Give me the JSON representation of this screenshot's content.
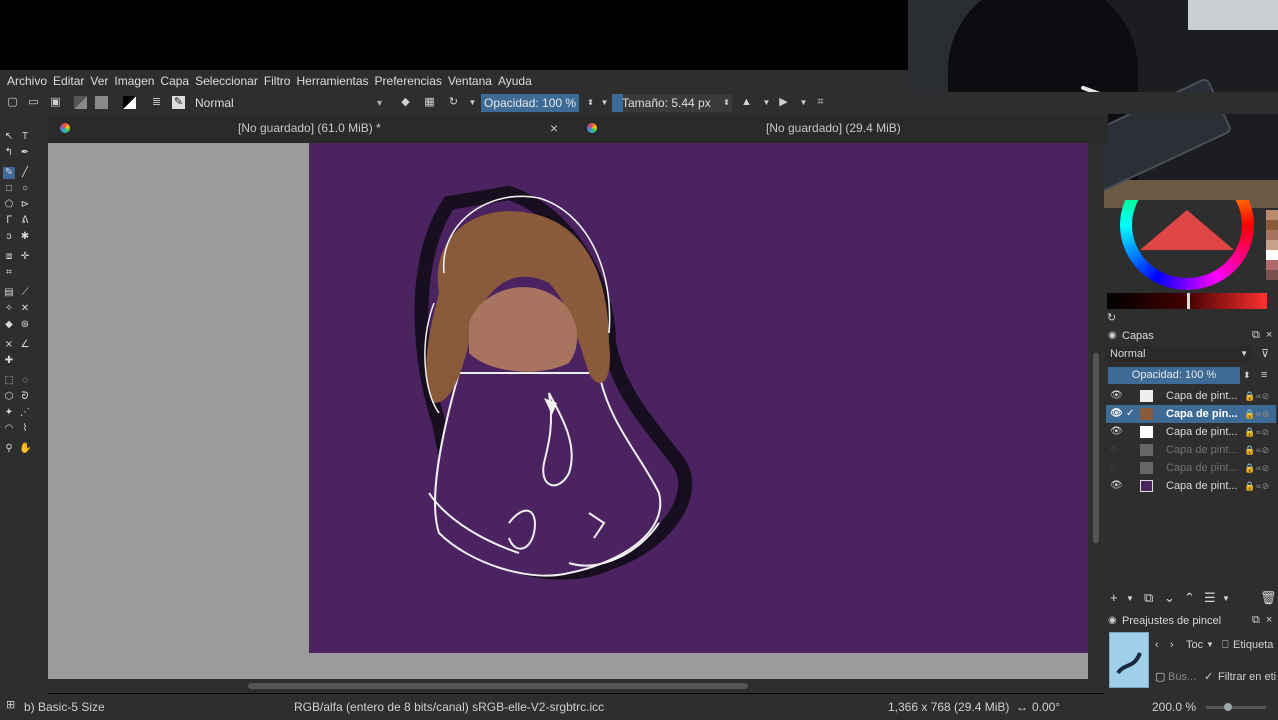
{
  "menu": [
    "Archivo",
    "Editar",
    "Ver",
    "Imagen",
    "Capa",
    "Seleccionar",
    "Filtro",
    "Herramientas",
    "Preferencias",
    "Ventana",
    "Ayuda"
  ],
  "toolbar": {
    "blend_mode": "Normal",
    "opacity": "Opacidad: 100 %",
    "size": "Tamaño: 5.44 px",
    "size_fraction": 0.09
  },
  "tabs": [
    {
      "title": "[No guardado]  (61.0 MiB) *"
    },
    {
      "title": "[No guardado]  (29.4 MiB)"
    }
  ],
  "layers_docker": {
    "title": "Capas",
    "blend_mode": "Normal",
    "opacity": "Opacidad:  100 %",
    "layers": [
      {
        "name": "Capa de pint...",
        "visible": true,
        "selected": false
      },
      {
        "name": "Capa de pin...",
        "visible": true,
        "selected": true
      },
      {
        "name": "Capa de pint...",
        "visible": true,
        "selected": false
      },
      {
        "name": "Capa de pint...",
        "visible": false,
        "selected": false
      },
      {
        "name": "Capa de pint...",
        "visible": false,
        "selected": false
      },
      {
        "name": "Capa de pint...",
        "visible": true,
        "selected": false
      }
    ]
  },
  "brush_presets": {
    "title": "Preajustes de pincel",
    "tag_select": "Toc",
    "tag_label": "Etiqueta",
    "search_placeholder": "Bus...",
    "filter_label": "Filtrar en eti"
  },
  "status": {
    "brush": "b) Basic-5 Size",
    "color_model": "RGB/alfa (entero de 8 bits/canal)  sRGB-elle-V2-srgbtrc.icc",
    "dimensions": "1,366 x 768 (29.4 MiB)",
    "rotation": "0.00°",
    "zoom": "200.0 %"
  },
  "colors": {
    "canvas_bg": "#4a2360",
    "selection": "#3e6a96",
    "panel_bg": "#2e2e2e"
  },
  "icons": {
    "close": "×",
    "eye": "👁",
    "add": "+",
    "delete": "🗑"
  }
}
